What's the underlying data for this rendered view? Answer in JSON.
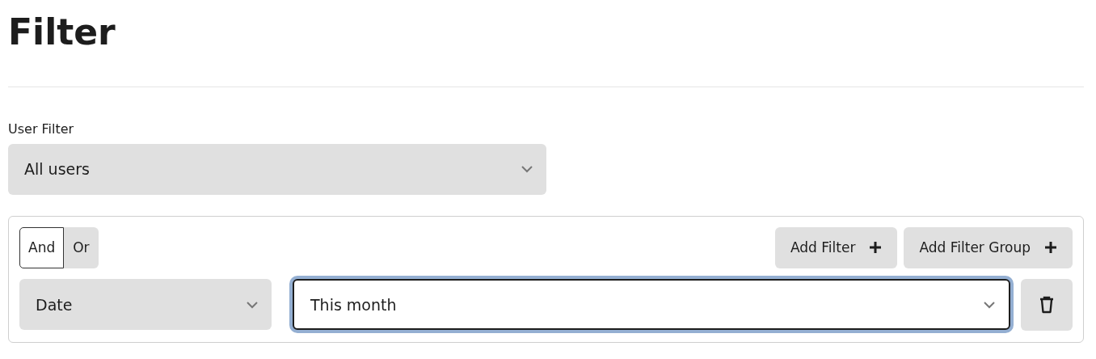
{
  "title": "Filter",
  "user_filter": {
    "label": "User Filter",
    "value": "All users"
  },
  "logic": [
    {
      "label": "And",
      "selected": true
    },
    {
      "label": "Or",
      "selected": false
    }
  ],
  "buttons": [
    {
      "label": "Add Filter"
    },
    {
      "label": "Add Filter Group"
    }
  ],
  "conditions": [
    {
      "field": "Date",
      "value": "This month",
      "focused": true
    }
  ]
}
